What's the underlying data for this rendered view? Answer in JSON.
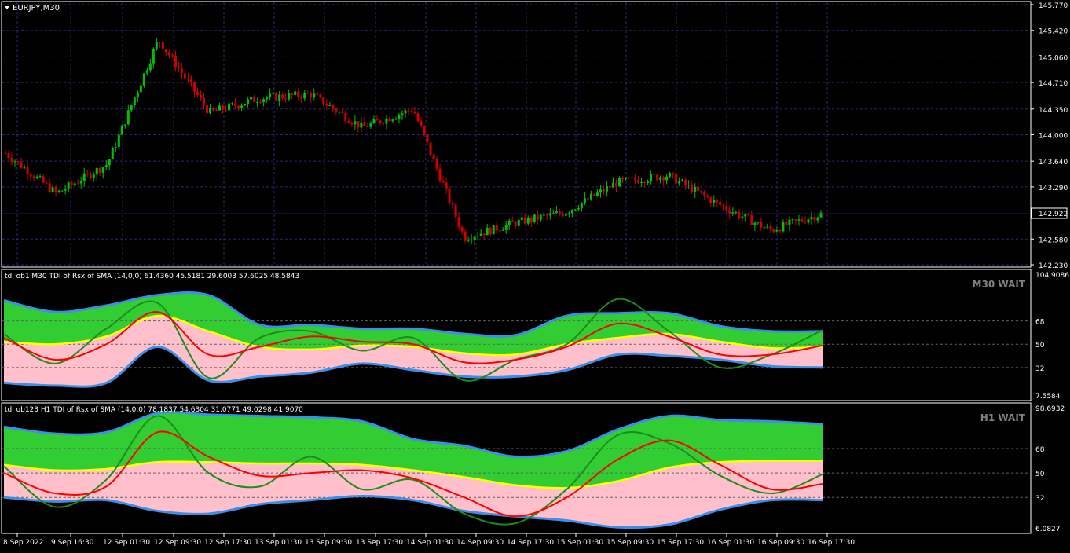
{
  "symbol_label": "EURJPY,M30",
  "colors": {
    "background": "#000000",
    "grid": "#2a2a6a",
    "frame": "#ffffff",
    "bull": "#00c000",
    "bear": "#d00000",
    "price_line": "#3b3bd0",
    "band_upper": "#3a8fe8",
    "band_lower": "#3a8fe8",
    "fill_upper": "#32cd32",
    "fill_lower": "#ffc0cb",
    "mid_band": "#ffff00",
    "rsi_line": "#1c8c1c",
    "signal_line": "#ff0000",
    "wait_text": "#808080"
  },
  "time_axis": [
    "8 Sep 2022",
    "9 Sep 16:30",
    "12 Sep 01:30",
    "12 Sep 09:30",
    "12 Sep 17:30",
    "13 Sep 01:30",
    "13 Sep 09:30",
    "13 Sep 17:30",
    "14 Sep 01:30",
    "14 Sep 09:30",
    "14 Sep 17:30",
    "15 Sep 01:30",
    "15 Sep 09:30",
    "15 Sep 17:30",
    "16 Sep 01:30",
    "16 Sep 09:30",
    "16 Sep 17:30"
  ],
  "price_panel": {
    "ticks": [
      "145.770",
      "145.420",
      "145.060",
      "144.710",
      "144.350",
      "144.000",
      "143.640",
      "143.290",
      "142.580",
      "142.230"
    ],
    "tick_values": [
      145.77,
      145.42,
      145.06,
      144.71,
      144.35,
      144.0,
      143.64,
      143.29,
      142.58,
      142.23
    ],
    "current_price": "142.922",
    "current_value": 142.922
  },
  "panel_m30": {
    "header": "tdi ob1 M30 TDI of Rsx of SMA (14,0,0) 61.4360 45.5181 29.6003 57.6025 48.5843",
    "status": "M30 WAIT",
    "top_label": "104.9086",
    "bottom_label": "7.5584",
    "levels": [
      "68",
      "50",
      "32"
    ]
  },
  "panel_h1": {
    "header": "tdi ob123 H1 TDI of Rsx of SMA (14,0,0) 78.1837 54.6304 31.0771 49.0298 41.9070",
    "status": "H1 WAIT",
    "top_label": "98.6932",
    "bottom_label": "6.0827",
    "levels": [
      "68",
      "50",
      "32"
    ]
  },
  "chart_data": [
    {
      "type": "line",
      "title": "EURJPY,M30",
      "ylim": [
        142.23,
        145.77
      ],
      "x": [
        "8 Sep 2022",
        "9 Sep 16:30",
        "12 Sep 01:30",
        "12 Sep 09:30",
        "12 Sep 17:30",
        "13 Sep 01:30",
        "13 Sep 09:30",
        "13 Sep 17:30",
        "14 Sep 01:30",
        "14 Sep 09:30",
        "14 Sep 17:30",
        "15 Sep 01:30",
        "15 Sep 09:30",
        "15 Sep 17:30",
        "16 Sep 01:30",
        "16 Sep 09:30",
        "16 Sep 17:30"
      ],
      "series": [
        {
          "name": "close",
          "values": [
            143.75,
            143.2,
            143.6,
            145.3,
            144.3,
            144.5,
            144.55,
            144.1,
            144.35,
            142.6,
            142.8,
            142.95,
            143.35,
            143.45,
            143.05,
            142.7,
            142.92
          ]
        }
      ]
    },
    {
      "type": "area",
      "title": "tdi ob1 M30 TDI of Rsx of SMA (14,0,0)",
      "ylim": [
        7.5584,
        104.9086
      ],
      "x": [
        "8 Sep 2022",
        "9 Sep 16:30",
        "12 Sep 01:30",
        "12 Sep 09:30",
        "12 Sep 17:30",
        "13 Sep 01:30",
        "13 Sep 09:30",
        "13 Sep 17:30",
        "14 Sep 01:30",
        "14 Sep 09:30",
        "14 Sep 17:30",
        "15 Sep 01:30",
        "15 Sep 09:30",
        "15 Sep 17:30",
        "16 Sep 01:30",
        "16 Sep 09:30",
        "16 Sep 17:30"
      ],
      "series": [
        {
          "values": [
            84,
            75,
            80,
            88,
            88,
            65,
            65,
            62,
            62,
            58,
            57,
            72,
            74,
            74,
            64,
            60,
            60
          ]
        },
        {
          "values": [
            52,
            50,
            56,
            72,
            60,
            48,
            46,
            49,
            48,
            43,
            42,
            50,
            55,
            58,
            52,
            47,
            48
          ]
        },
        {
          "values": [
            20,
            18,
            20,
            48,
            22,
            25,
            28,
            35,
            30,
            25,
            25,
            30,
            42,
            41,
            38,
            33,
            32
          ]
        },
        {
          "values": [
            58,
            35,
            62,
            82,
            24,
            55,
            60,
            45,
            55,
            22,
            38,
            50,
            85,
            60,
            32,
            42,
            61
          ]
        },
        {
          "values": [
            55,
            38,
            50,
            75,
            42,
            48,
            56,
            52,
            50,
            36,
            38,
            48,
            66,
            56,
            42,
            42,
            49
          ]
        }
      ],
      "levels": [
        68,
        50,
        32
      ]
    },
    {
      "type": "area",
      "title": "tdi ob123 H1 TDI of Rsx of SMA (14,0,0)",
      "ylim": [
        6.0827,
        98.6932
      ],
      "x": [
        "8 Sep 2022",
        "9 Sep 16:30",
        "12 Sep 01:30",
        "12 Sep 09:30",
        "12 Sep 17:30",
        "13 Sep 01:30",
        "13 Sep 09:30",
        "13 Sep 17:30",
        "14 Sep 01:30",
        "14 Sep 09:30",
        "14 Sep 17:30",
        "15 Sep 01:30",
        "15 Sep 09:30",
        "15 Sep 17:30",
        "16 Sep 01:30",
        "16 Sep 09:30",
        "16 Sep 17:30"
      ],
      "series": [
        {
          "values": [
            84,
            79,
            80,
            94,
            93,
            92,
            91,
            88,
            75,
            70,
            62,
            66,
            82,
            92,
            89,
            88,
            86
          ]
        },
        {
          "values": [
            56,
            52,
            53,
            58,
            58,
            57,
            57,
            56,
            52,
            47,
            41,
            39,
            44,
            54,
            58,
            59,
            59
          ]
        },
        {
          "values": [
            32,
            29,
            30,
            22,
            20,
            27,
            30,
            33,
            30,
            22,
            18,
            15,
            10,
            12,
            23,
            30,
            30
          ]
        },
        {
          "values": [
            55,
            25,
            45,
            92,
            50,
            40,
            62,
            38,
            45,
            20,
            13,
            38,
            78,
            72,
            48,
            35,
            49
          ]
        },
        {
          "values": [
            50,
            35,
            40,
            80,
            62,
            48,
            50,
            52,
            46,
            32,
            18,
            32,
            60,
            74,
            56,
            38,
            42
          ]
        }
      ],
      "levels": [
        68,
        50,
        32
      ]
    }
  ]
}
